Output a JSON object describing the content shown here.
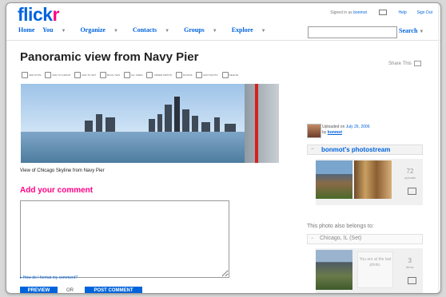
{
  "header": {
    "logo_blue": "flick",
    "logo_pink": "r",
    "nav": [
      "Home",
      "You",
      "Organize",
      "Contacts",
      "Groups",
      "Explore"
    ],
    "signed_in_prefix": "Signed in as",
    "username": "bonmot",
    "help": "Help",
    "sign_out": "Sign Out",
    "search_placeholder": "",
    "search_label": "Search"
  },
  "photo": {
    "title": "Panoramic view from Navy Pier",
    "share": "Share This",
    "caption": "View of Chicago Skyline from Navy Pier",
    "tools": [
      "ADD NOTE",
      "ADD TO GROUP",
      "ADD TO SET",
      "BLOG THIS",
      "ALL SIZES",
      "ORDER PRINTS",
      "ROTATE",
      "EDIT PHOTO",
      "DELETE"
    ]
  },
  "comment": {
    "heading": "Add your comment",
    "format_link": "How do I format my comment?",
    "preview": "PREVIEW",
    "or": "OR",
    "post": "POST COMMENT"
  },
  "sidebar": {
    "uploaded_prefix": "Uploaded on",
    "uploaded_date": "July 26, 2006",
    "by": "by",
    "uploader": "bonmot",
    "photostream": "bonmot's photostream",
    "stream_count": "72",
    "stream_count_label": "uploads",
    "belongs": "This photo also belongs to:",
    "set_name": "Chicago, IL (Set)",
    "last_photo": "You are at the last photo.",
    "set_count": "3",
    "set_count_label": "items"
  }
}
